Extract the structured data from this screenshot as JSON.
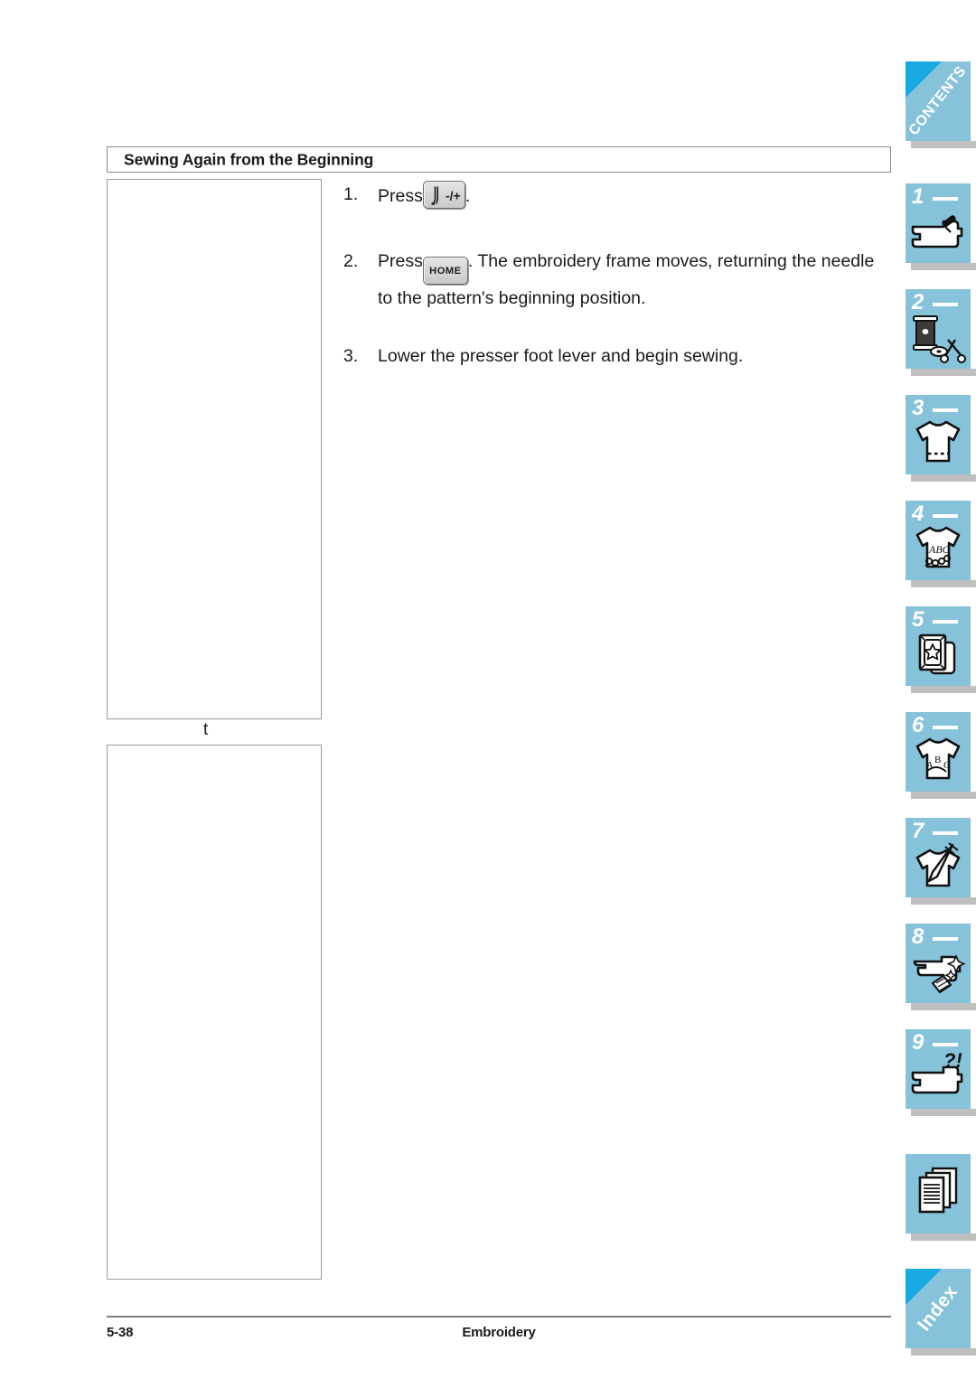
{
  "document": {
    "section_title": "Sewing Again from the Beginning",
    "stray_character": "t"
  },
  "steps": [
    {
      "number": "1.",
      "before_key": "Press",
      "key": "needle-position",
      "key_label": "-/+",
      "after_key": ".",
      "second_line": ""
    },
    {
      "number": "2.",
      "before_key": "Press",
      "key": "home",
      "key_label": "HOME",
      "after_key": ". The embroidery frame moves, returning the needle",
      "second_line": "to the pattern's beginning position."
    },
    {
      "number": "3.",
      "before_key": "Lower the presser foot lever and begin sewing.",
      "key": "",
      "key_label": "",
      "after_key": "",
      "second_line": ""
    }
  ],
  "footer": {
    "page_number": "5-38",
    "chapter": "Embroidery"
  },
  "tabs": [
    {
      "id": "contents",
      "label": "CONTENTS",
      "number": "",
      "icon": "contents-corner-icon"
    },
    {
      "id": "ch1",
      "label": "",
      "number": "1",
      "icon": "sewing-machine-icon"
    },
    {
      "id": "ch2",
      "label": "",
      "number": "2",
      "icon": "thread-spool-bobbin-scissors-icon"
    },
    {
      "id": "ch3",
      "label": "",
      "number": "3",
      "icon": "shirt-stitch-icon"
    },
    {
      "id": "ch4",
      "label": "",
      "number": "4",
      "icon": "shirt-abc-decorative-icon"
    },
    {
      "id": "ch5",
      "label": "",
      "number": "5",
      "icon": "memory-card-star-icon"
    },
    {
      "id": "ch6",
      "label": "",
      "number": "6",
      "icon": "shirt-lettering-icon"
    },
    {
      "id": "ch7",
      "label": "",
      "number": "7",
      "icon": "shirt-needle-repair-icon"
    },
    {
      "id": "ch8",
      "label": "",
      "number": "8",
      "icon": "machine-cleaning-icon"
    },
    {
      "id": "ch9",
      "label": "",
      "number": "9",
      "icon": "machine-troubleshooting-icon"
    },
    {
      "id": "appendix",
      "label": "",
      "number": "",
      "icon": "stacked-pages-icon"
    },
    {
      "id": "index",
      "label": "Index",
      "number": "",
      "icon": "index-corner-icon"
    }
  ],
  "colors": {
    "tab_face": "#86c2da",
    "tab_corner_accent": "#18a9e0",
    "tab_shadow": "#bfbfbf",
    "rule": "#7d7d7d",
    "text": "#1a1a1a"
  }
}
